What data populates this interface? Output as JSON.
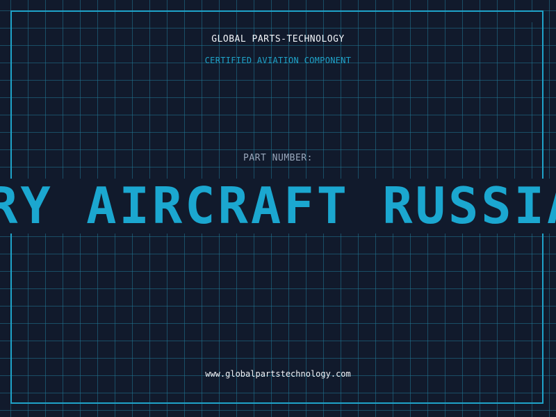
{
  "header": {
    "brand": "GLOBAL PARTS-TECHNOLOGY",
    "subtitle": "CERTIFIED AVIATION COMPONENT"
  },
  "part": {
    "label": "PART NUMBER:",
    "value": "MILITARY AIRCRAFT RUSSIAN"
  },
  "footer": {
    "url": "www.globalpartstechnology.com"
  },
  "colors": {
    "background": "#111a2c",
    "grid": "#207896",
    "accent": "#1ba7d0",
    "text": "#f2f4f8",
    "muted": "#9aa8bc"
  }
}
